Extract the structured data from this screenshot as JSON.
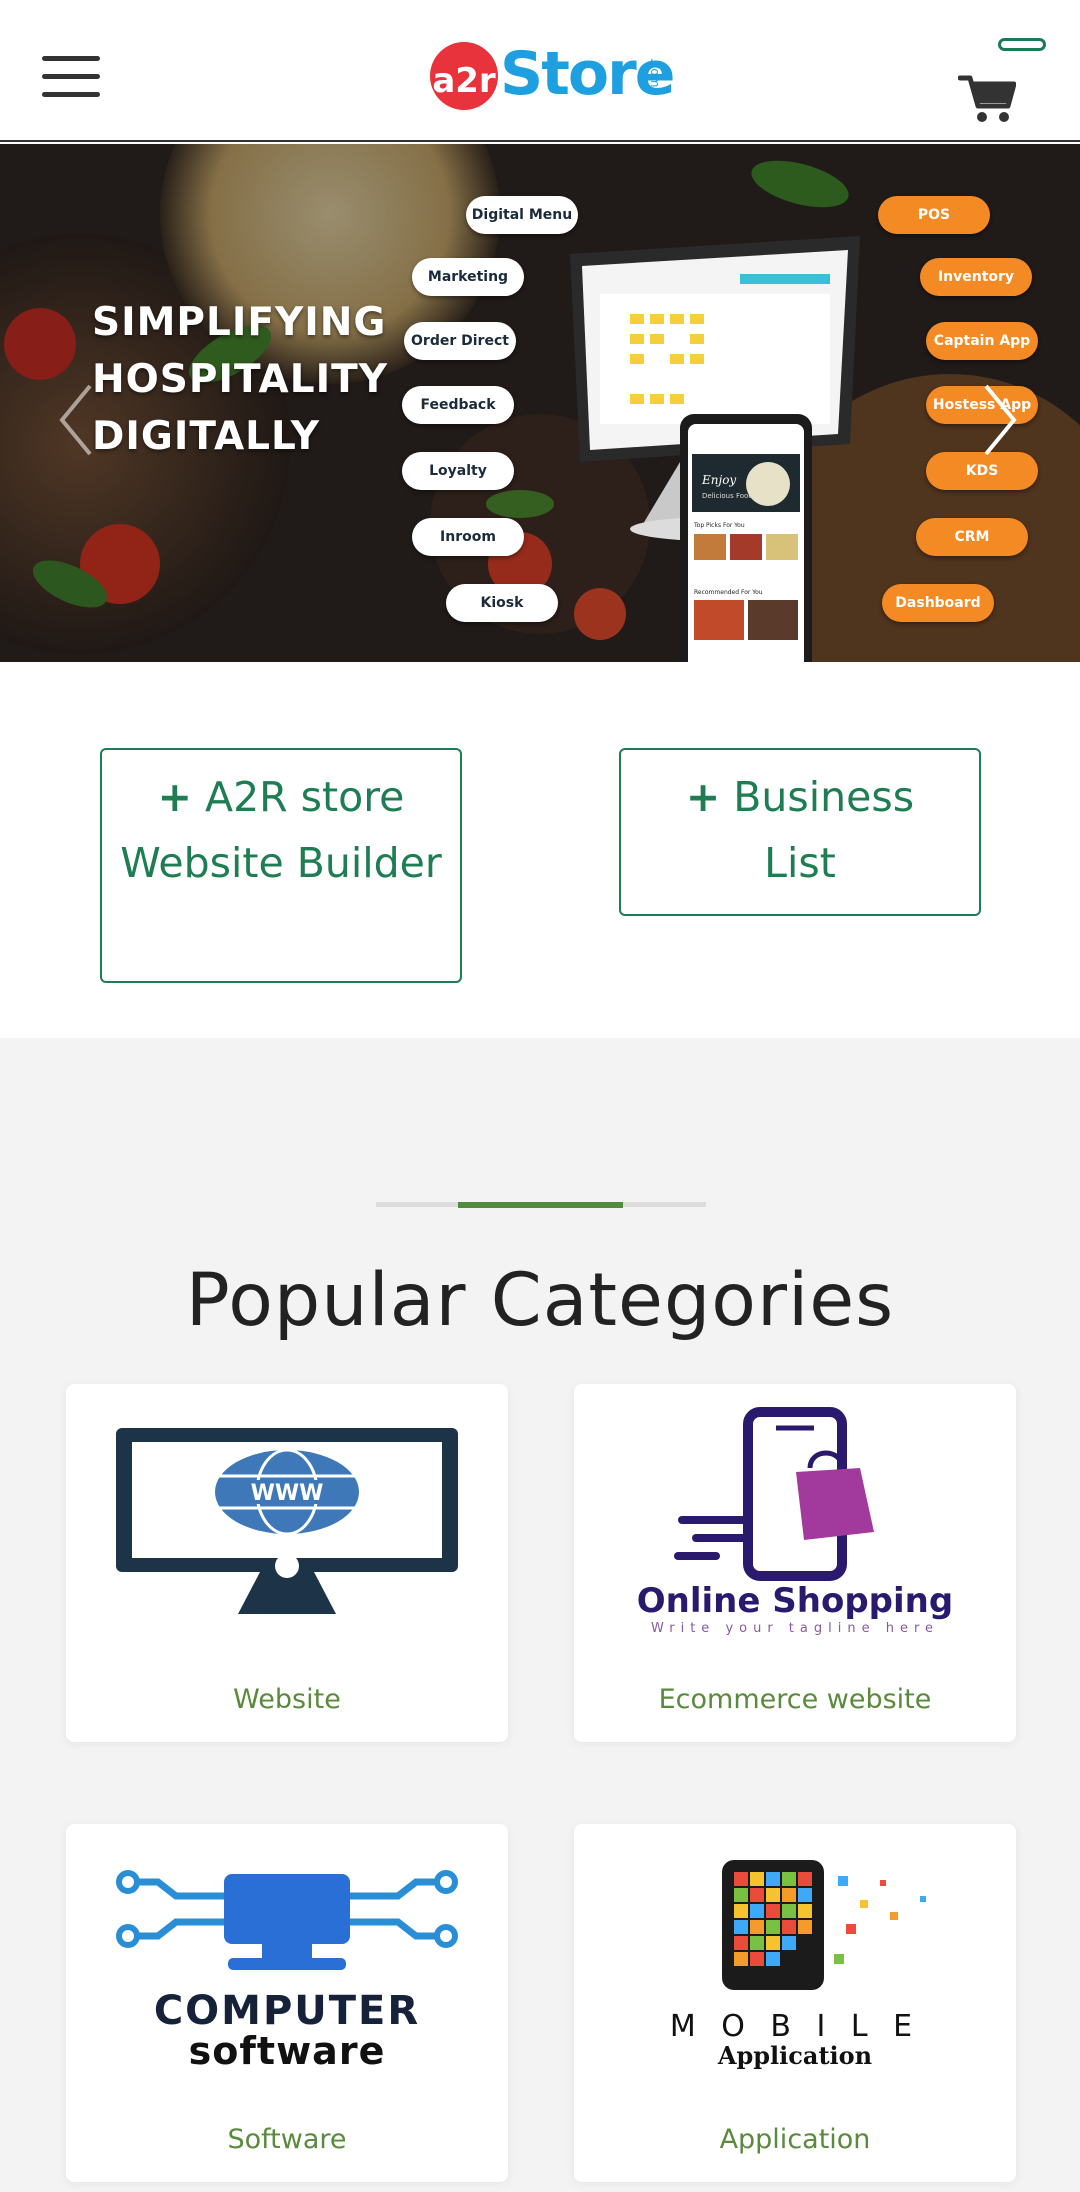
{
  "header": {
    "logo_prefix": "a2r",
    "logo_main": "Store",
    "logo_suffix": ".com"
  },
  "banner": {
    "title_lines": [
      "SIMPLIFYING",
      "HOSPITALITY",
      "DIGITALLY"
    ],
    "left_pills": [
      "Digital Menu",
      "Marketing",
      "Order Direct",
      "Feedback",
      "Loyalty",
      "Inroom",
      "Kiosk"
    ],
    "right_pills": [
      "POS",
      "Inventory",
      "Captain App",
      "Hostess App",
      "KDS",
      "CRM",
      "Dashboard"
    ],
    "phone_texts": [
      "Enjoy",
      "Delicious Food",
      "Top Picks For You",
      "Recommended For You"
    ]
  },
  "actions": {
    "website_builder_label": "A2R store Website Builder",
    "business_list_label": "Business List",
    "plus_icon": "+"
  },
  "categories": {
    "title": "Popular Categories",
    "items": [
      {
        "label": "Website",
        "image_text": "WWW"
      },
      {
        "label": "Ecommerce website",
        "image_text": "Online Shopping",
        "image_subtext": "Write your tagline here"
      },
      {
        "label": "Software",
        "image_text": "COMPUTER",
        "image_subtext": "software"
      },
      {
        "label": "Application",
        "image_text": "M O B I L E",
        "image_subtext": "Application"
      }
    ]
  },
  "colors": {
    "brand_red": "#e8323c",
    "brand_blue": "#1e9fe0",
    "accent_green": "#1e7d53",
    "category_green": "#5a8a3c",
    "pill_orange": "#f38a24"
  }
}
